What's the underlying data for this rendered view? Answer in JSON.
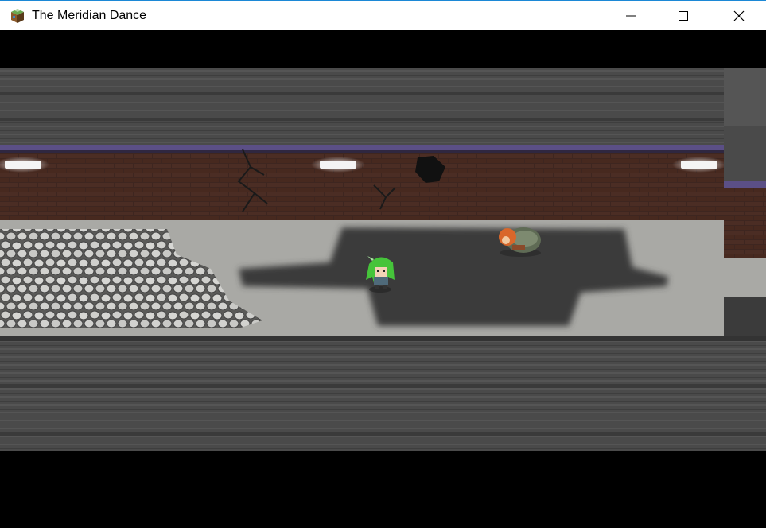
{
  "window": {
    "title": "The Meridian Dance",
    "app_icon": "game-cube-icon",
    "controls": {
      "minimize_icon": "minimize-icon",
      "maximize_icon": "maximize-icon",
      "close_icon": "close-icon"
    }
  },
  "colors": {
    "title_bar_bg": "#ffffff",
    "title_bar_border": "#1c88d6",
    "letterbox": "#000000",
    "ceiling": "#4a4a4a",
    "brick": "#3e2620",
    "floor": "#a9a9a5",
    "trim": "#5b4f86",
    "shadow_floor": "#3a3a3a"
  },
  "scene": {
    "player_sprite": "green-haired-girl-sprite",
    "npc_sprite": "curled-up-figure-sprite",
    "lights": [
      "ceiling-light-left",
      "ceiling-light-center",
      "ceiling-light-right"
    ]
  }
}
